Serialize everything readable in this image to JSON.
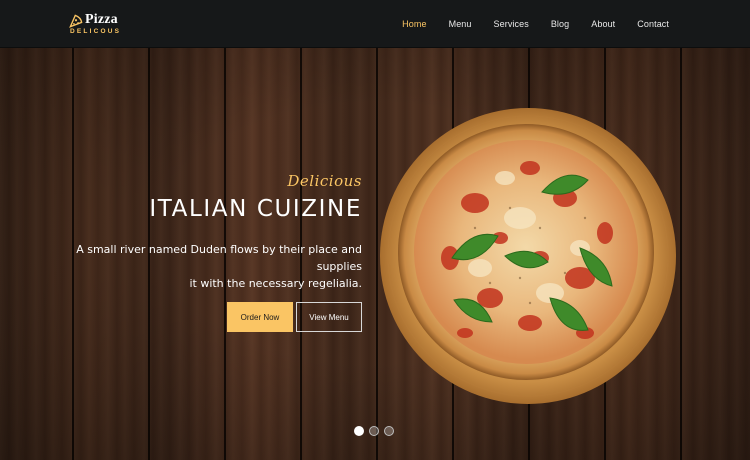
{
  "brand": {
    "name": "Pizza",
    "subtitle": "DELICOUS"
  },
  "nav": {
    "items": [
      {
        "label": "Home",
        "active": true
      },
      {
        "label": "Menu"
      },
      {
        "label": "Services"
      },
      {
        "label": "Blog"
      },
      {
        "label": "About"
      },
      {
        "label": "Contact"
      }
    ]
  },
  "hero": {
    "tagline": "Delicious",
    "headline": "ITALIAN CUIZINE",
    "description_line1": "A small river named Duden flows by their place and supplies",
    "description_line2": "it with the necessary regelialia.",
    "primary_button": "Order Now",
    "secondary_button": "View Menu",
    "slides": 3,
    "active_slide": 1
  },
  "colors": {
    "accent": "#fac564",
    "navbar_bg": "#161819"
  },
  "icons": {
    "logo": "pizza-slice-icon"
  }
}
